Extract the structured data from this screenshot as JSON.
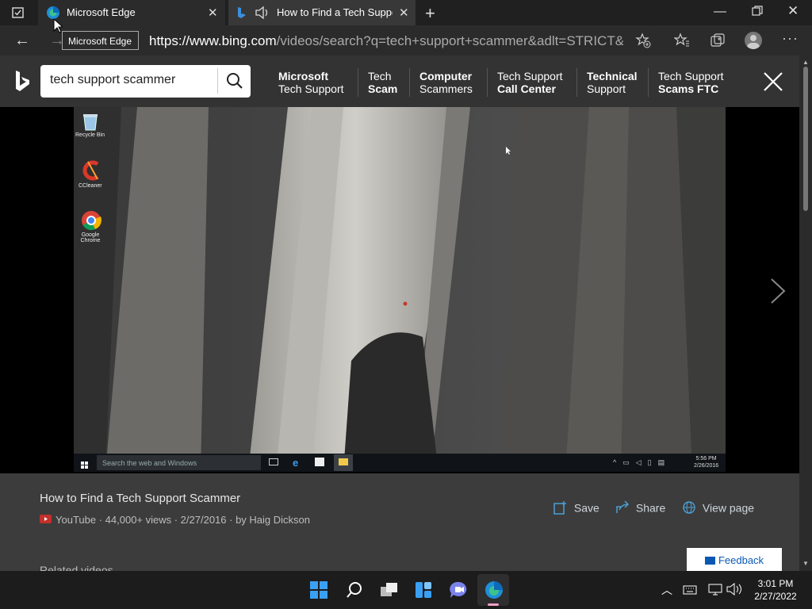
{
  "browser": {
    "tabs": [
      {
        "title": "Microsoft Edge"
      },
      {
        "title": "How to Find a Tech Support Scammer"
      }
    ],
    "tooltip": "Microsoft Edge",
    "url_domain": "https://www.bing.com",
    "url_rest": "/videos/search?q=tech+support+scammer&adlt=STRICT&vi..."
  },
  "bing": {
    "query": "tech support scammer",
    "related": [
      {
        "l1": "Microsoft",
        "l2": "Tech Support"
      },
      {
        "l1": "Tech",
        "l2": "Scam"
      },
      {
        "l1": "Computer",
        "l2": "Scammers"
      },
      {
        "l1": "Tech Support",
        "l2": "Call Center"
      },
      {
        "l1": "Technical",
        "l2": "Support"
      },
      {
        "l1": "Tech Support",
        "l2": "Scams FTC"
      }
    ]
  },
  "video": {
    "desktop_icons": [
      "Recycle Bin",
      "CCleaner",
      "Google Chrome"
    ],
    "search_placeholder": "Search the web and Windows",
    "inner_time": "5:56 PM",
    "inner_date": "2/26/2016",
    "title": "How to Find a Tech Support Scammer",
    "source": "YouTube",
    "meta": "· 44,000+ views · 2/27/2016 · by Haig Dickson",
    "actions": {
      "save": "Save",
      "share": "Share",
      "view": "View page"
    },
    "related_heading": "Related videos",
    "feedback": "Feedback"
  },
  "taskbar": {
    "time": "3:01 PM",
    "date": "2/27/2022"
  },
  "colors": {
    "accent": "#0a58b4",
    "bing_bar": "#333333",
    "youtube": "#c4302b"
  }
}
